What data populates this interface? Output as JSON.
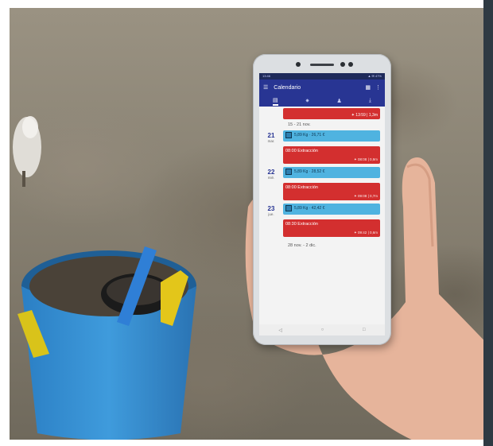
{
  "phone": {
    "status_time": "13:46",
    "status_icons": "▲ ✉ 47%",
    "app_title": "Calendario",
    "tabs": [
      "calendar-icon",
      "sun-icon",
      "person-icon",
      "download-icon"
    ],
    "top_event_detail": "✦ 13:59 | 1,3m",
    "weeks": [
      {
        "label": "15 - 21 nov."
      },
      {
        "label": "28 nov. - 2 dic."
      }
    ],
    "days": [
      {
        "num": "21",
        "name": "mar.",
        "catch": "5,89 Kg · 26,71 €",
        "extraction_title": "08:00 Extracción",
        "extraction_detail": "✦ 08:08 | 0,9m"
      },
      {
        "num": "22",
        "name": "mié.",
        "catch": "5,89 Kg · 28,52 €",
        "extraction_title": "08:00 Extracción",
        "extraction_detail": "✦ 09:08 | 0,7m"
      },
      {
        "num": "23",
        "name": "jue.",
        "catch": "5,89 Kg · 42,42 €",
        "extraction_title": "08:30 Extracción",
        "extraction_detail": "✦ 09:42 | 0,6m"
      }
    ],
    "nav": [
      "◁",
      "○",
      "□"
    ]
  },
  "colors": {
    "app_bar": "#283593",
    "extraction": "#d32f2f",
    "catch": "#4fb3e0"
  }
}
